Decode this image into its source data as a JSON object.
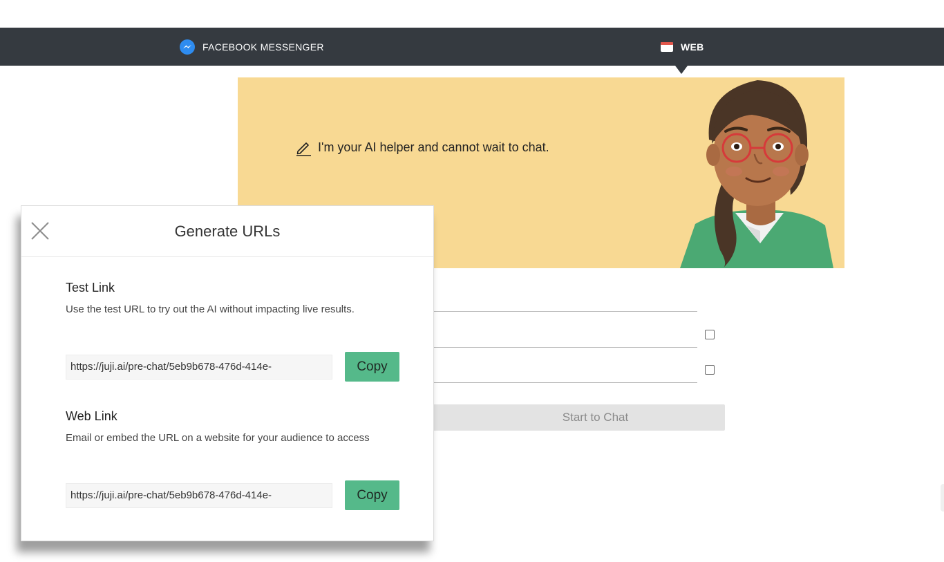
{
  "nav": {
    "tabs": [
      {
        "label": "FACEBOOK MESSENGER",
        "icon": "messenger-icon"
      },
      {
        "label": "WEB",
        "icon": "browser-window-icon",
        "active": true
      }
    ]
  },
  "banner": {
    "greeting": "I'm your AI helper and cannot wait to chat.",
    "icon": "pencil-icon",
    "background_color": "#f8d993"
  },
  "form": {
    "start_button": "Start to Chat"
  },
  "modal": {
    "title": "Generate URLs",
    "test_link": {
      "heading": "Test Link",
      "description": "Use the test URL to try out the AI without impacting live results.",
      "url": "https://juji.ai/pre-chat/5eb9b678-476d-414e-",
      "copy_label": "Copy"
    },
    "web_link": {
      "heading": "Web Link",
      "description": "Email or embed the URL on a website for your audience to access",
      "url": "https://juji.ai/pre-chat/5eb9b678-476d-414e-",
      "copy_label": "Copy"
    },
    "accent_color": "#55b98a"
  }
}
